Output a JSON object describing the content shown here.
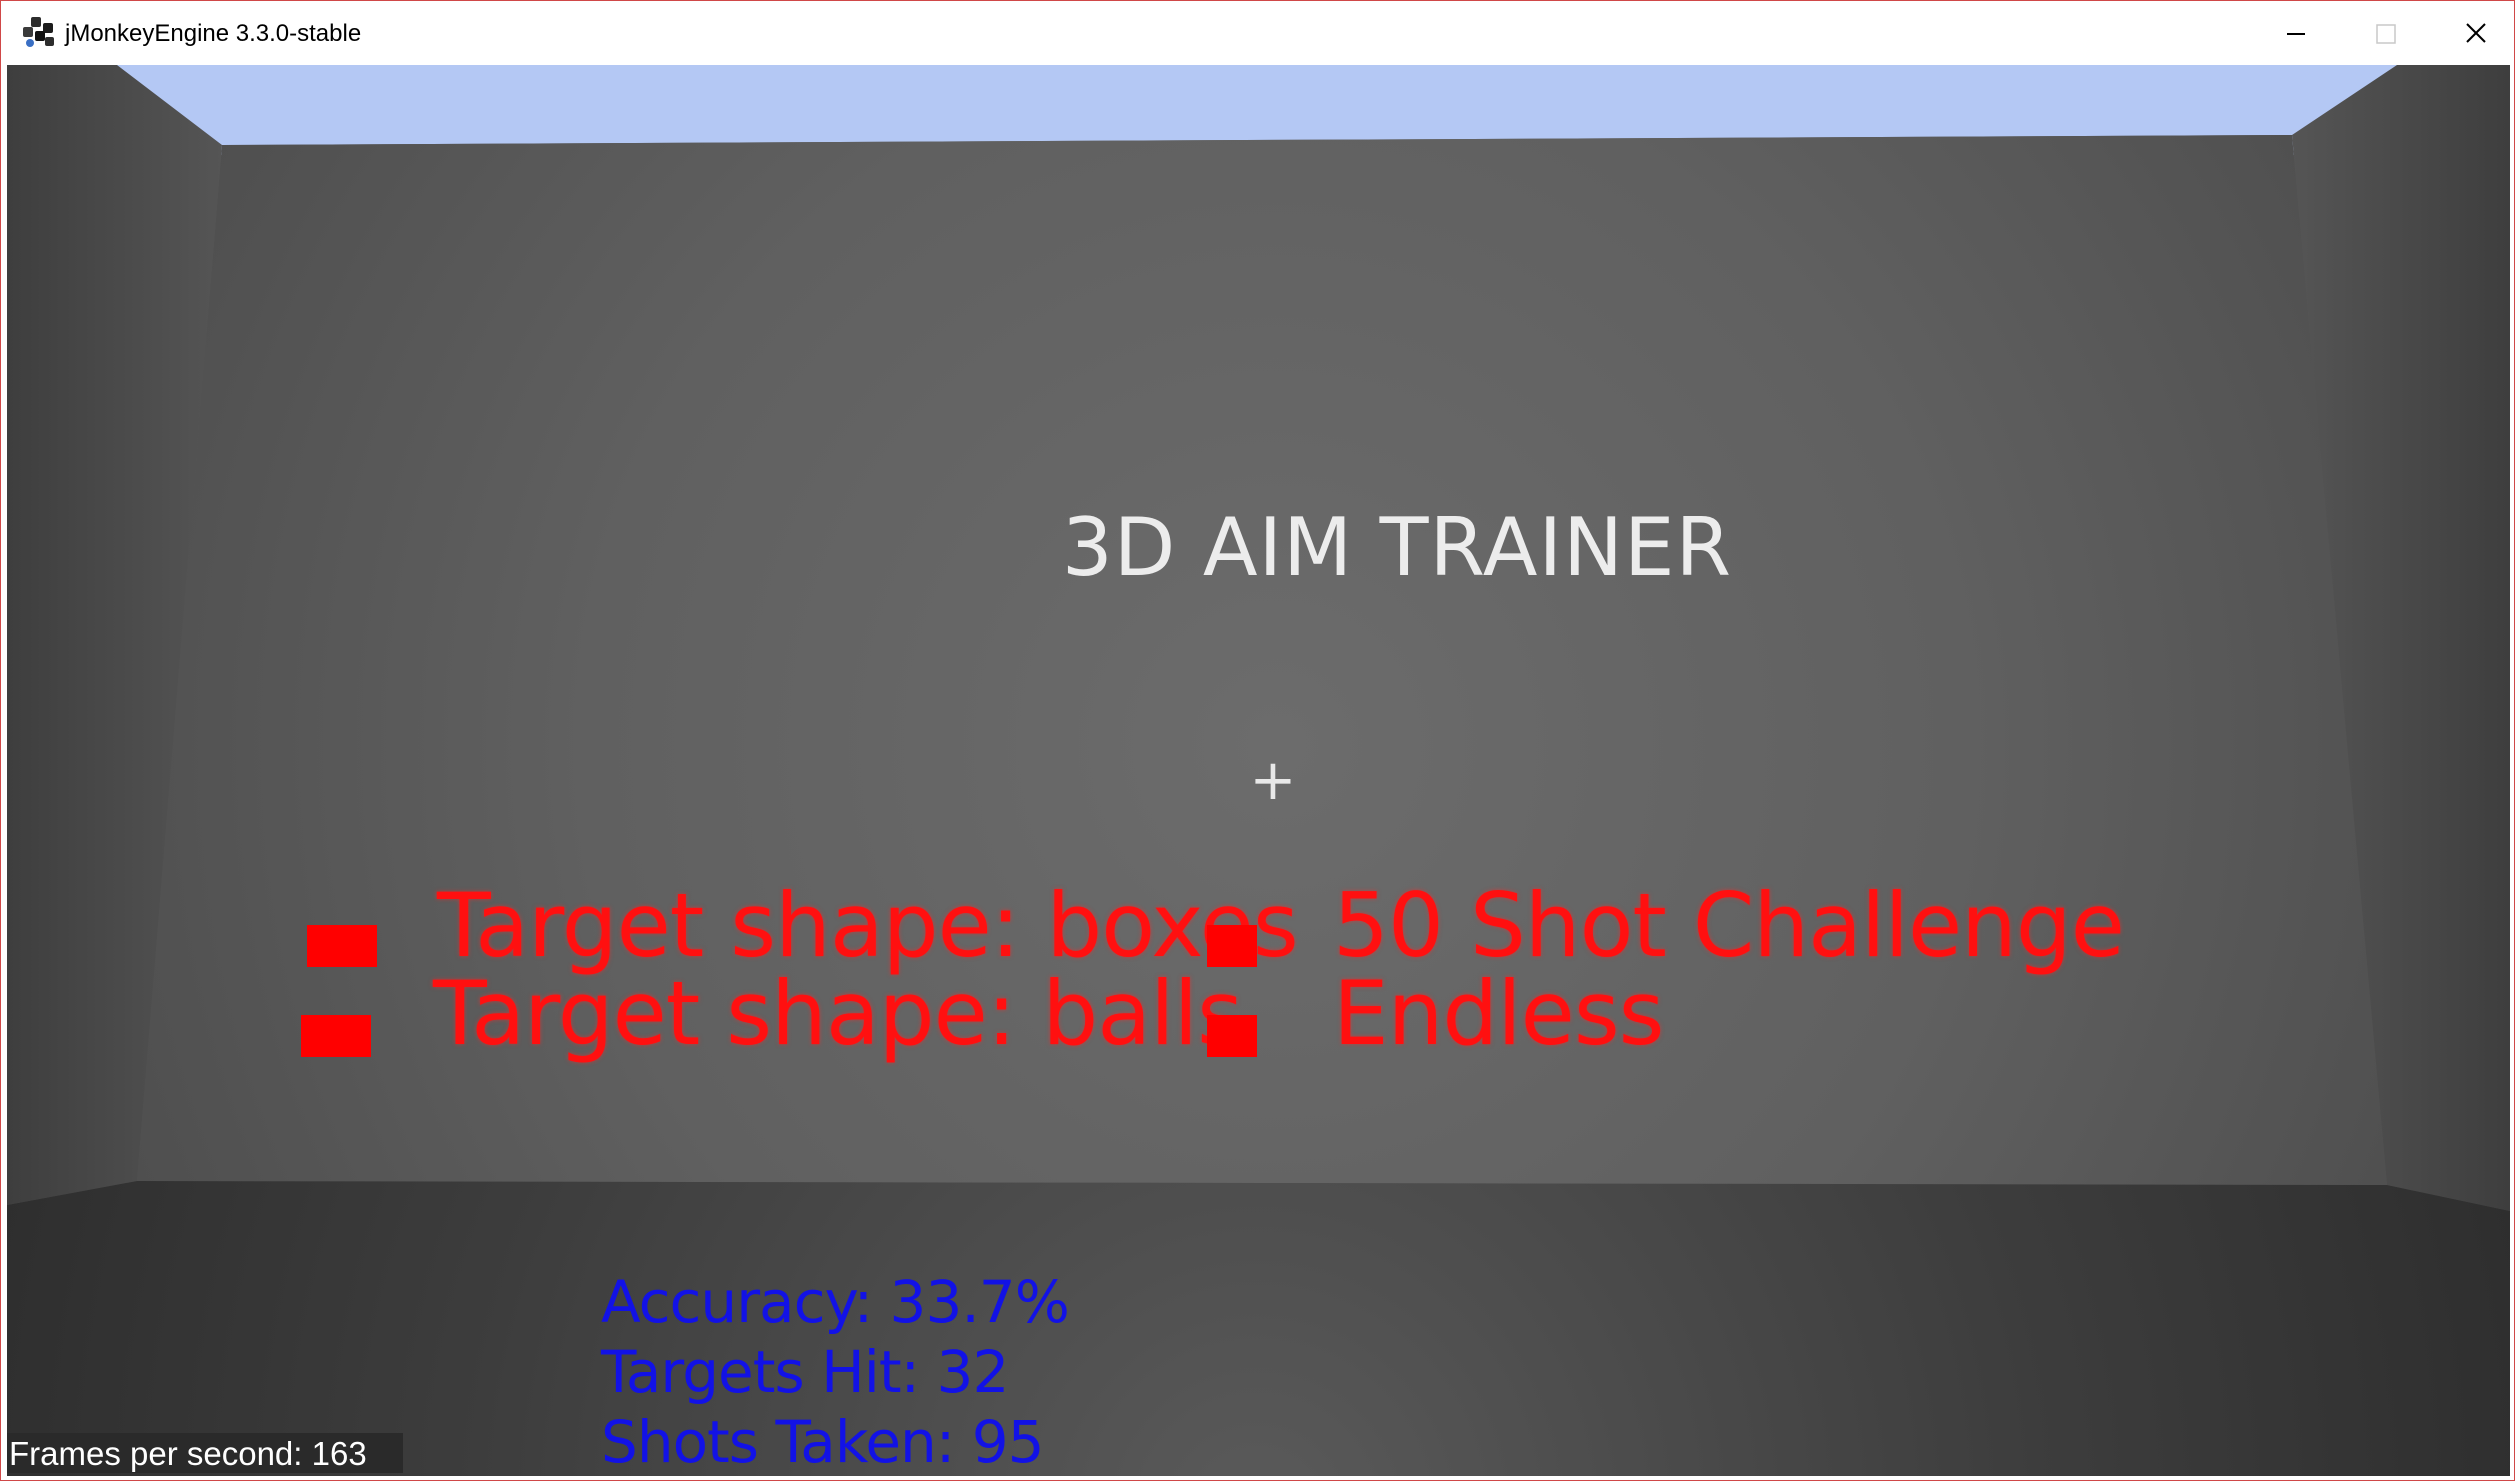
{
  "window": {
    "title": "jMonkeyEngine 3.3.0-stable",
    "controls": [
      "minimize-icon",
      "maximize-icon",
      "close-icon"
    ]
  },
  "game": {
    "title": "3D AIM TRAINER",
    "crosshair": "+",
    "menu": [
      {
        "label": "Target shape: boxes"
      },
      {
        "label": "50 Shot Challenge"
      },
      {
        "label": "Target shape: balls"
      },
      {
        "label": "Endless"
      }
    ],
    "stats": {
      "accuracy": "Accuracy: 33.7%",
      "targets_hit": "Targets Hit: 32",
      "shots_taken": "Shots Taken: 95"
    },
    "fps": "Frames per second: 163"
  },
  "colors": {
    "menu_text": "#ff1010",
    "menu_box": "#ff0000",
    "stats_text": "#1212e6",
    "sky": "#b4c8f4"
  }
}
